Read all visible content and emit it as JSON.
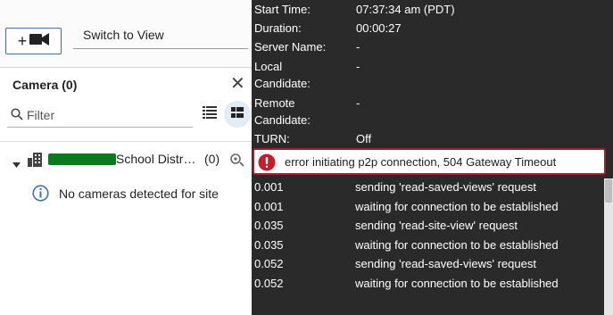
{
  "toolbar": {
    "add_camera_icon": "video-camera-icon",
    "switch_view_label": "Switch to View"
  },
  "camera_panel": {
    "title": "Camera (0)",
    "close_icon": "close-icon",
    "filter_placeholder": "Filter",
    "view_icons": [
      "list-view-icon",
      "grid-view-icon"
    ],
    "site": {
      "name_suffix": "School Distr…",
      "count": "(0)"
    },
    "empty_message": "No cameras detected for site"
  },
  "details": {
    "rows": [
      {
        "label": "Start Time:",
        "value": "07:37:34 am (PDT)"
      },
      {
        "label": "Duration:",
        "value": "00:00:27"
      },
      {
        "label": "Server Name:",
        "value": "-"
      },
      {
        "label": "Local Candidate:",
        "value": "-"
      },
      {
        "label": "Remote Candidate:",
        "value": "-"
      },
      {
        "label": "TURN:",
        "value": "Off"
      }
    ],
    "error": "error initiating p2p connection, 504 Gateway Timeout",
    "log": [
      {
        "time": "0.001",
        "message": "sending 'read-saved-views' request"
      },
      {
        "time": "0.001",
        "message": "waiting for connection to be established"
      },
      {
        "time": "0.035",
        "message": "sending 'read-site-view' request"
      },
      {
        "time": "0.035",
        "message": "waiting for connection to be established"
      },
      {
        "time": "0.052",
        "message": "sending 'read-saved-views' request"
      },
      {
        "time": "0.052",
        "message": "waiting for connection to be established"
      }
    ]
  },
  "colors": {
    "accent": "#3f6fb0",
    "overlay_bg": "#2a2a2a",
    "error": "#a81d2c",
    "redaction": "#0b7a1f"
  }
}
